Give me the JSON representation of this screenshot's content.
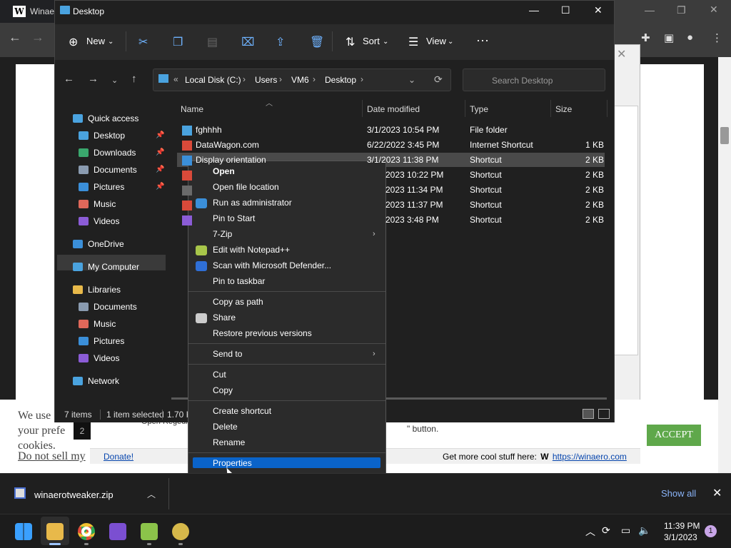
{
  "chrome": {
    "tab_title": "Winae",
    "download_filename": "winaerotweaker.zip",
    "show_all": "Show all"
  },
  "background_page": {
    "cookie_lines": [
      "We use",
      "your prefe",
      "cookies."
    ],
    "cookie_link": "Do not sell my",
    "accept": "ACCEPT",
    "donate": "Donate!",
    "cool_stuff": "Get more cool stuff here:",
    "cool_stuff_link": "https://winaero.com",
    "frag_button": "\" button.",
    "frag_open": "Open Regedit",
    "frag_num": "2"
  },
  "explorer": {
    "title": "Desktop",
    "commands": {
      "new": "New",
      "sort": "Sort",
      "view": "View"
    },
    "breadcrumb": [
      "Local Disk (C:)",
      "Users",
      "VM6",
      "Desktop"
    ],
    "search_placeholder": "Search Desktop",
    "nav": [
      {
        "label": "Quick access",
        "color": "#4aa3df"
      },
      {
        "label": "Desktop",
        "color": "#4aa3df"
      },
      {
        "label": "Downloads",
        "color": "#3aa76d"
      },
      {
        "label": "Documents",
        "color": "#8a9bb0"
      },
      {
        "label": "Pictures",
        "color": "#3b8fd9"
      },
      {
        "label": "Music",
        "color": "#e0685a"
      },
      {
        "label": "Videos",
        "color": "#8b5cd6"
      },
      {
        "label": "OneDrive",
        "color": "#3b8fd9"
      },
      {
        "label": "My Computer",
        "color": "#4aa3df"
      },
      {
        "label": "Libraries",
        "color": "#e8b94a"
      },
      {
        "label": "Documents",
        "color": "#8a9bb0"
      },
      {
        "label": "Music",
        "color": "#e0685a"
      },
      {
        "label": "Pictures",
        "color": "#3b8fd9"
      },
      {
        "label": "Videos",
        "color": "#8b5cd6"
      },
      {
        "label": "Network",
        "color": "#4aa3df"
      }
    ],
    "columns": [
      "Name",
      "Date modified",
      "Type",
      "Size"
    ],
    "files": [
      {
        "name": "fghhhh",
        "date": "3/1/2023 10:54 PM",
        "type": "File folder",
        "size": ""
      },
      {
        "name": "DataWagon.com",
        "date": "6/22/2022 3:45 PM",
        "type": "Internet Shortcut",
        "size": "1 KB"
      },
      {
        "name": "Display orientation",
        "date": "3/1/2023 11:38 PM",
        "type": "Shortcut",
        "size": "2 KB"
      },
      {
        "name": "",
        "date": "2023 10:22 PM",
        "type": "Shortcut",
        "size": "2 KB"
      },
      {
        "name": "",
        "date": "2023 11:34 PM",
        "type": "Shortcut",
        "size": "2 KB"
      },
      {
        "name": "",
        "date": "2023 11:37 PM",
        "type": "Shortcut",
        "size": "2 KB"
      },
      {
        "name": "",
        "date": "2023 3:48 PM",
        "type": "Shortcut",
        "size": "2 KB"
      }
    ],
    "status": {
      "items": "7 items",
      "selected": "1 item selected",
      "size": "1.70 K"
    }
  },
  "context_menu": [
    {
      "label": "Open",
      "bold": true
    },
    {
      "label": "Open file location"
    },
    {
      "label": "Run as administrator"
    },
    {
      "label": "Pin to Start"
    },
    {
      "label": "7-Zip",
      "submenu": true
    },
    {
      "label": "Edit with Notepad++"
    },
    {
      "label": "Scan with Microsoft Defender..."
    },
    {
      "label": "Pin to taskbar"
    },
    {
      "label": "Copy as path"
    },
    {
      "label": "Share"
    },
    {
      "label": "Restore previous versions"
    },
    {
      "label": "Send to",
      "submenu": true
    },
    {
      "label": "Cut"
    },
    {
      "label": "Copy"
    },
    {
      "label": "Create shortcut"
    },
    {
      "label": "Delete"
    },
    {
      "label": "Rename"
    },
    {
      "label": "Properties",
      "highlighted": true
    }
  ],
  "taskbar": {
    "time": "11:39 PM",
    "date": "3/1/2023",
    "notifications": "1"
  },
  "colors": {
    "accent": "#0a63c9",
    "accept_green": "#5fa84b",
    "link_blue": "#0645ad",
    "showall_blue": "#8ab4f8"
  }
}
